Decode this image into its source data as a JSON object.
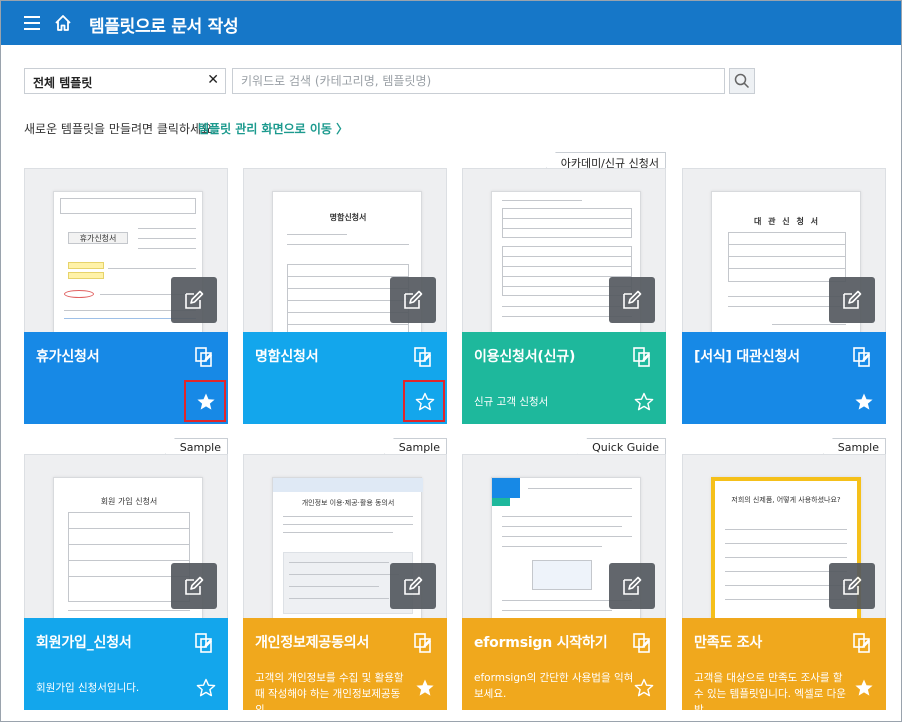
{
  "header": {
    "title": "템플릿으로 문서 작성",
    "bg_color": "#1677c8"
  },
  "search": {
    "category_value": "전체 템플릿",
    "clear_symbol": "✕",
    "placeholder": "키워드로 검색 (카테고리명, 템플릿명)"
  },
  "hint": {
    "text": "새로운 템플릿을 만들려면 클릭하세요.",
    "link": "템플릿 관리 화면으로 이동 〉"
  },
  "colors": {
    "blue": "#1789e6",
    "teal": "#1eb89c",
    "orange": "#f0a81d"
  },
  "cards": [
    {
      "name": "휴가신청서",
      "tag": "",
      "desc": "",
      "starred": true,
      "highlighted": true,
      "color": "#1789e6",
      "doc_title": "휴가신청서"
    },
    {
      "name": "명함신청서",
      "tag": "",
      "desc": "",
      "starred": false,
      "highlighted": true,
      "color": "#1789e6",
      "doc_title": "명함신청서"
    },
    {
      "name": "이용신청서(신규)",
      "tag": "아카데미/신규 신청서",
      "desc": "신규 고객 신청서",
      "starred": false,
      "highlighted": false,
      "color": "#1eb89c",
      "doc_title": ""
    },
    {
      "name": "[서식] 대관신청서",
      "tag": "",
      "desc": "",
      "starred": true,
      "highlighted": false,
      "color": "#1789e6",
      "doc_title": "대 관 신 청 서"
    },
    {
      "name": "회원가입_신청서",
      "tag": "Sample",
      "desc": "회원가입 신청서입니다.",
      "starred": false,
      "highlighted": false,
      "color": "#1789e6",
      "doc_title": "회원 가입 신청서"
    },
    {
      "name": "개인정보제공동의서",
      "tag": "Sample",
      "desc": "고객의 개인정보를 수집 및 활용할 때 작성해야 하는 개인정보제공동의…",
      "starred": true,
      "highlighted": false,
      "color": "#f0a81d",
      "doc_title": "개인정보 이용·제공·활용 동의서"
    },
    {
      "name": "eformsign 시작하기",
      "tag": "Quick Guide",
      "desc": "eformsign의 간단한 사용법을 익혀 보세요.",
      "starred": false,
      "highlighted": false,
      "color": "#f0a81d",
      "doc_title": ""
    },
    {
      "name": "만족도 조사",
      "tag": "Sample",
      "desc": "고객을 대상으로 만족도 조사를 할 수 있는 템플릿입니다. 엑셀로 다운받…",
      "starred": true,
      "highlighted": false,
      "color": "#f0a81d",
      "doc_title": "저희의 신제품, 어떻게 사용하셨나요?"
    }
  ]
}
